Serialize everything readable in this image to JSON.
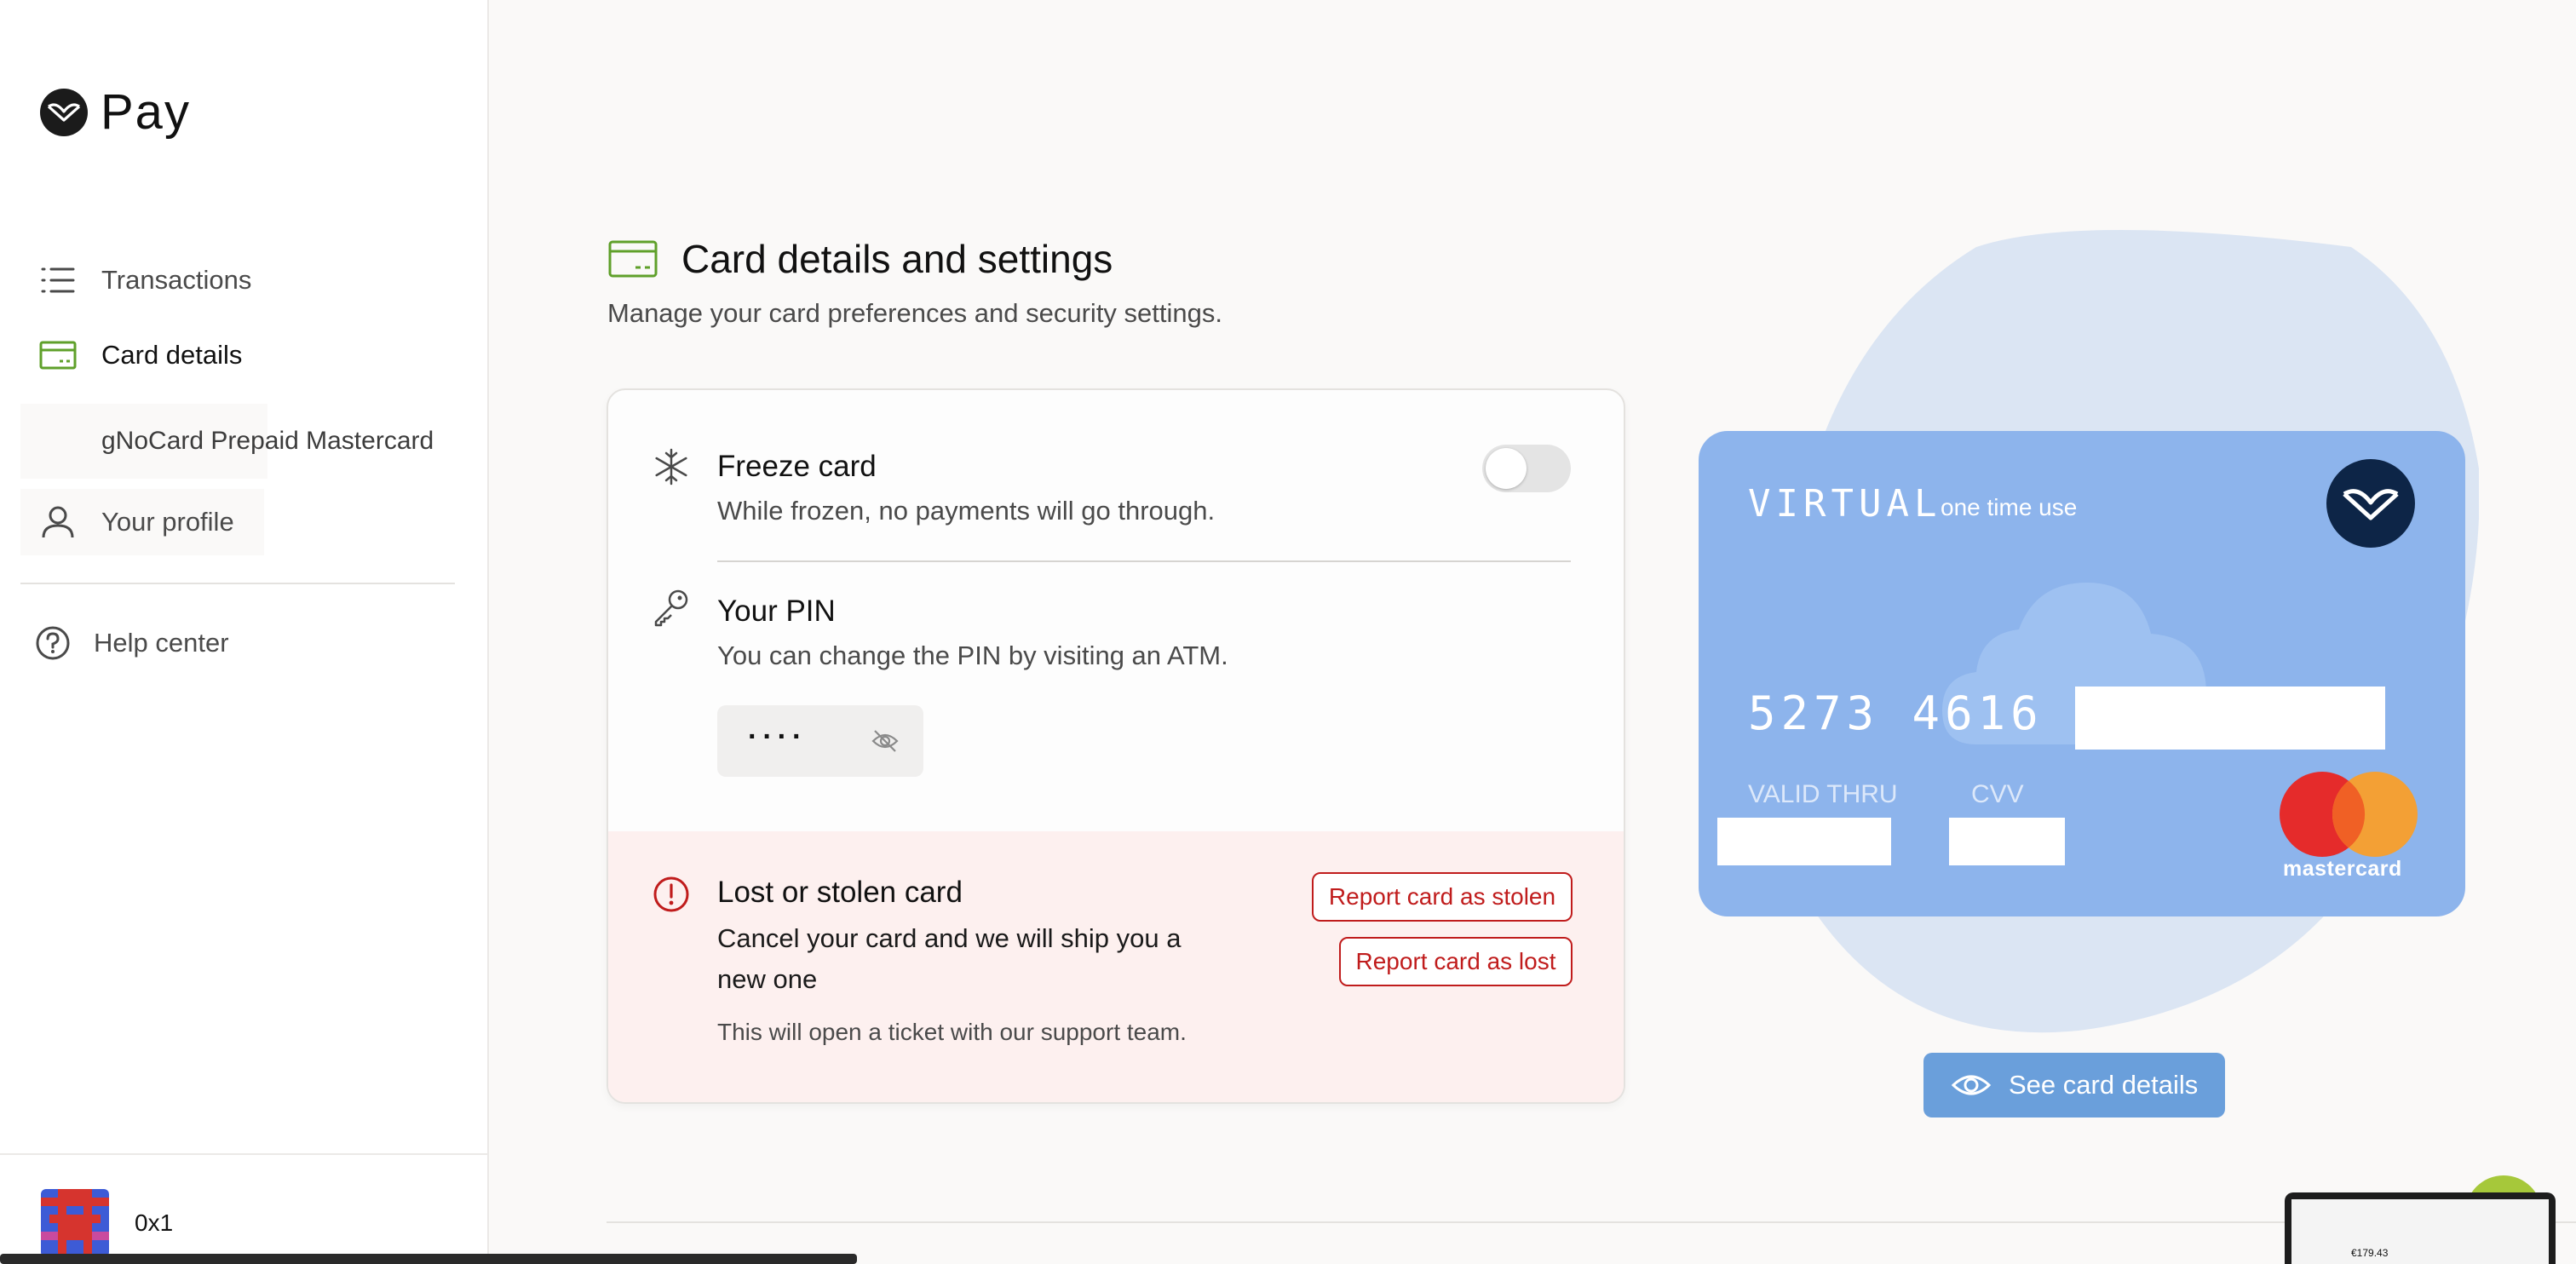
{
  "app": {
    "logo_text": "Pay"
  },
  "sidebar": {
    "items": [
      {
        "label": "Transactions",
        "icon": "list-icon"
      },
      {
        "label": "Card details",
        "icon": "card-icon"
      },
      {
        "label": "gNoCard Prepaid Mastercard"
      },
      {
        "label": "Your profile",
        "icon": "user-icon"
      },
      {
        "label": "Help center",
        "icon": "help-circle-icon"
      }
    ],
    "user": {
      "name": "0x1"
    }
  },
  "header": {
    "title": "Card details and settings",
    "subtitle": "Manage your card preferences and security settings."
  },
  "settings": {
    "freeze": {
      "title": "Freeze card",
      "description": "While frozen, no payments will go through.",
      "enabled": false
    },
    "pin": {
      "title": "Your PIN",
      "description": "You can change the PIN by visiting an ATM.",
      "masked_value": "····"
    },
    "lost": {
      "title": "Lost or stolen card",
      "description": "Cancel your card and we will ship you a new one",
      "note": "This will open a ticket with our support team.",
      "stolen_button": "Report card as stolen",
      "lost_button": "Report card as lost"
    }
  },
  "card": {
    "type": "VIRTUAL",
    "usage": "one time use",
    "number_visible": "5273 4616",
    "valid_thru_label": "VALID THRU",
    "cvv_label": "CVV",
    "network": "mastercard",
    "see_details_button": "See card details"
  },
  "preview": {
    "amount": "€179.43"
  },
  "colors": {
    "accent_green": "#5fa02a",
    "danger_red": "#c01c1c",
    "card_blue": "#8db4ec",
    "button_blue": "#6a9fdb"
  }
}
